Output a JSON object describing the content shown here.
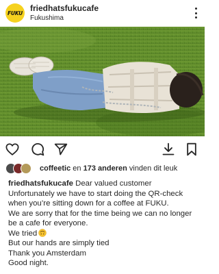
{
  "post": {
    "avatar_text": "FUKU",
    "username": "friedhatsfukucafe",
    "location": "Fukushima",
    "more_icon": "vertical-ellipsis-icon"
  },
  "photo": {
    "description_icon": "photo",
    "colors": {
      "grass": "#5f8c2a",
      "shirt": "#e8e2d6",
      "jeans": "#7f9fc8",
      "hair": "#2a211c"
    }
  },
  "actions": {
    "like_icon": "heart-outline-icon",
    "comment_icon": "comment-bubble-icon",
    "share_icon": "paper-plane-icon",
    "download_icon": "download-icon",
    "save_icon": "bookmark-icon"
  },
  "likes": {
    "first_user": "coffeetic",
    "middle": " en ",
    "others": "173 anderen",
    "suffix": " vinden dit leuk"
  },
  "caption": {
    "username": "friedhatsfukucafe",
    "lines": [
      "Dear valued customer",
      "Unfortunately we have to start doing the QR-check",
      "when you’re sitting down for a coffee at FUKU.",
      "We are sorry that for the time being we can no longer",
      "be a cafe for everyone.",
      "We tried",
      "But our hands are simply tied",
      "Thank you Amsterdam",
      "Good night."
    ],
    "emoji_icon": "upside-down-face-emoji-icon"
  }
}
